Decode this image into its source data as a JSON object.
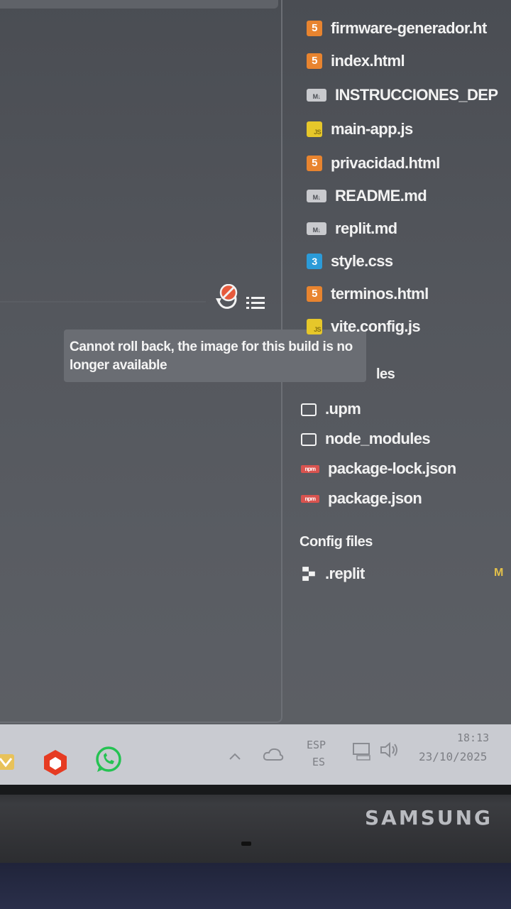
{
  "file_tree": {
    "files": [
      {
        "name": "firmware-generador.ht",
        "icon": "html5-icon"
      },
      {
        "name": "index.html",
        "icon": "html5-icon"
      },
      {
        "name": "INSTRUCCIONES_DEP",
        "icon": "markdown-icon"
      },
      {
        "name": "main-app.js",
        "icon": "javascript-icon"
      },
      {
        "name": "privacidad.html",
        "icon": "html5-icon"
      },
      {
        "name": "README.md",
        "icon": "markdown-icon"
      },
      {
        "name": "replit.md",
        "icon": "markdown-icon"
      },
      {
        "name": "style.css",
        "icon": "css3-icon"
      },
      {
        "name": "terminos.html",
        "icon": "html5-icon"
      },
      {
        "name": "vite.config.js",
        "icon": "javascript-icon"
      }
    ],
    "partial_label": "les",
    "packager_files": [
      {
        "name": ".upm",
        "icon": "folder-icon"
      },
      {
        "name": "node_modules",
        "icon": "folder-icon"
      },
      {
        "name": "package-lock.json",
        "icon": "npm-icon"
      },
      {
        "name": "package.json",
        "icon": "npm-icon"
      }
    ],
    "config_section_label": "Config files",
    "config_files": [
      {
        "name": ".replit",
        "icon": "replit-icon",
        "badge": "M"
      }
    ]
  },
  "tooltip": {
    "text": "Cannot roll back, the image for this build is no longer available"
  },
  "toolbar": {
    "rollback_icon": "rollback-disabled-icon",
    "list_icon": "list-icon"
  },
  "taskbar": {
    "apps": [
      "app-icon",
      "office-icon",
      "whatsapp-icon"
    ],
    "tray": {
      "lang_top": "ESP",
      "lang_bottom": "ES",
      "time": "18:13",
      "date": "23/10/2025"
    }
  },
  "monitor": {
    "brand": "SAMSUNG"
  },
  "colors": {
    "html_icon": "#e8842f",
    "js_icon": "#e6c72a",
    "css_icon": "#2b9bd8",
    "npm_icon": "#d9534f",
    "modified_badge": "#e3c04a"
  }
}
